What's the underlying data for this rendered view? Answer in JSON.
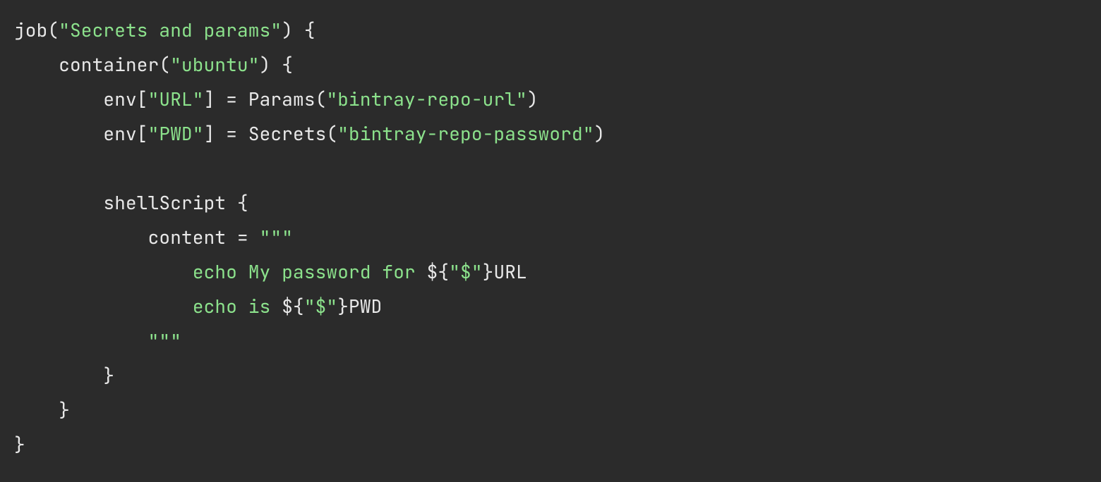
{
  "colors": {
    "background": "#2b2b2b",
    "default": "#e8e8e8",
    "string": "#8ce28c"
  },
  "code": {
    "l1": {
      "a": "job(",
      "b": "\"Secrets and params\"",
      "c": ") {"
    },
    "l2": {
      "a": "    container(",
      "b": "\"ubuntu\"",
      "c": ") {"
    },
    "l3": {
      "a": "        env[",
      "b": "\"URL\"",
      "c": "] = Params(",
      "d": "\"bintray-repo-url\"",
      "e": ")"
    },
    "l4": {
      "a": "        env[",
      "b": "\"PWD\"",
      "c": "] = Secrets(",
      "d": "\"bintray-repo-password\"",
      "e": ")"
    },
    "l5": {
      "a": ""
    },
    "l6": {
      "a": "        shellScript {"
    },
    "l7": {
      "a": "            content = ",
      "b": "\"\"\""
    },
    "l8": {
      "a": "                ",
      "b": "echo My password for ",
      "c": "${",
      "d": "\"$\"",
      "e": "}URL"
    },
    "l9": {
      "a": "                ",
      "b": "echo is ",
      "c": "${",
      "d": "\"$\"",
      "e": "}PWD"
    },
    "l10": {
      "a": "            ",
      "b": "\"\"\""
    },
    "l11": {
      "a": "        }"
    },
    "l12": {
      "a": "    }"
    },
    "l13": {
      "a": "}"
    }
  }
}
